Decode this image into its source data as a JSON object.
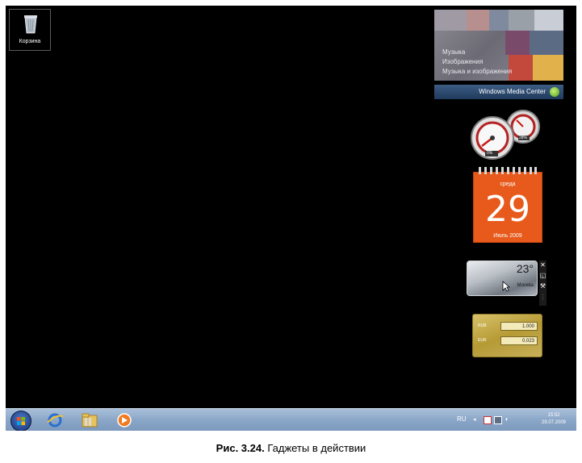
{
  "desktop": {
    "recycle_bin_label": "Корзина"
  },
  "media_center": {
    "menu": [
      "Музыка",
      "Изображения",
      "Музыка и изображения"
    ],
    "brand": "Windows Media Center"
  },
  "calendar": {
    "weekday": "среда",
    "day": "29",
    "month_year": "Июль 2009"
  },
  "cpu_meter": {
    "cpu_label": "0%",
    "memory_label": "28%"
  },
  "weather": {
    "temperature": "23°",
    "city": "Москва"
  },
  "currency": {
    "rows": [
      {
        "code": "RUB",
        "value": "1.000"
      },
      {
        "code": "EUR",
        "value": "0.023"
      }
    ]
  },
  "taskbar": {
    "language": "RU",
    "time": "15:52",
    "date": "29.07.2009"
  },
  "caption": {
    "label": "Рис. 3.24.",
    "text": " Гаджеты в действии"
  },
  "colors": {
    "desktop": "#000000",
    "calendar": "#e75a1c",
    "taskbar": "#8aa6c7"
  }
}
